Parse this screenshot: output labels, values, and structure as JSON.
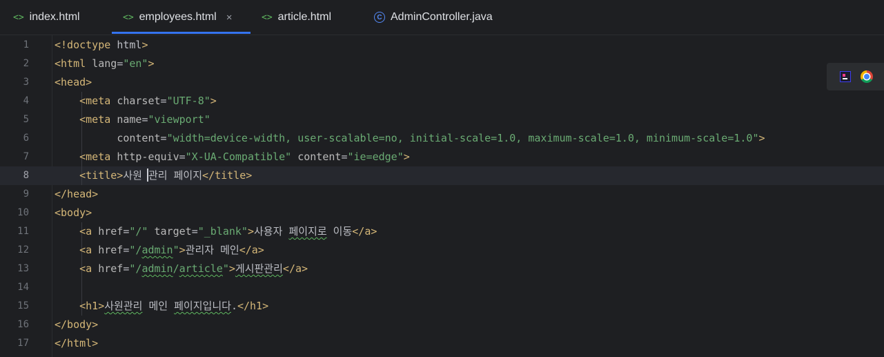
{
  "tabs": [
    {
      "icon": "<>",
      "label": "index.html"
    },
    {
      "icon": "<>",
      "label": "employees.html",
      "close": "×"
    },
    {
      "icon": "<>",
      "label": "article.html"
    },
    {
      "icon": "C",
      "label": "AdminController.java"
    }
  ],
  "lines": [
    {
      "n": "1",
      "parts": [
        [
          "tag",
          "<!doctype "
        ],
        [
          "txt",
          "html"
        ],
        [
          "tag",
          ">"
        ]
      ]
    },
    {
      "n": "2",
      "parts": [
        [
          "tag",
          "<html "
        ],
        [
          "attr",
          "lang"
        ],
        [
          "txt",
          "="
        ],
        [
          "str",
          "\"en\""
        ],
        [
          "tag",
          ">"
        ]
      ]
    },
    {
      "n": "3",
      "parts": [
        [
          "tag",
          "<head>"
        ]
      ]
    },
    {
      "n": "4",
      "parts": [
        [
          "txt",
          "    "
        ],
        [
          "tag",
          "<meta "
        ],
        [
          "attr",
          "charset"
        ],
        [
          "txt",
          "="
        ],
        [
          "str",
          "\"UTF-8\""
        ],
        [
          "tag",
          ">"
        ]
      ]
    },
    {
      "n": "5",
      "parts": [
        [
          "txt",
          "    "
        ],
        [
          "tag",
          "<meta "
        ],
        [
          "attr",
          "name"
        ],
        [
          "txt",
          "="
        ],
        [
          "str",
          "\"viewport\""
        ]
      ]
    },
    {
      "n": "6",
      "parts": [
        [
          "txt",
          "          "
        ],
        [
          "attr",
          "content"
        ],
        [
          "txt",
          "="
        ],
        [
          "str",
          "\"width=device-width, user-scalable=no, initial-scale=1.0, maximum-scale=1.0, minimum-scale=1.0\""
        ],
        [
          "tag",
          ">"
        ]
      ]
    },
    {
      "n": "7",
      "parts": [
        [
          "txt",
          "    "
        ],
        [
          "tag",
          "<meta "
        ],
        [
          "attr",
          "http-equiv"
        ],
        [
          "txt",
          "="
        ],
        [
          "str",
          "\"X-UA-Compatible\""
        ],
        [
          "txt",
          " "
        ],
        [
          "attr",
          "content"
        ],
        [
          "txt",
          "="
        ],
        [
          "str",
          "\"ie=edge\""
        ],
        [
          "tag",
          ">"
        ]
      ]
    },
    {
      "n": "8",
      "parts": [
        [
          "txt",
          "    "
        ],
        [
          "tag",
          "<title>"
        ],
        [
          "txt",
          "사원 "
        ],
        [
          "caret",
          ""
        ],
        [
          "txt",
          "관리 페이지"
        ],
        [
          "tag",
          "</title>"
        ]
      ]
    },
    {
      "n": "9",
      "parts": [
        [
          "tag",
          "</head>"
        ]
      ]
    },
    {
      "n": "10",
      "parts": [
        [
          "tag",
          "<body>"
        ]
      ]
    },
    {
      "n": "11",
      "parts": [
        [
          "txt",
          "    "
        ],
        [
          "tag",
          "<a "
        ],
        [
          "attr",
          "href"
        ],
        [
          "txt",
          "="
        ],
        [
          "str",
          "\"/\""
        ],
        [
          "txt",
          " "
        ],
        [
          "attr",
          "target"
        ],
        [
          "txt",
          "="
        ],
        [
          "str",
          "\"_blank\""
        ],
        [
          "tag",
          ">"
        ],
        [
          "txt",
          "사용자 "
        ],
        [
          "wtxt",
          "페이지로"
        ],
        [
          "txt",
          " 이동"
        ],
        [
          "tag",
          "</a>"
        ]
      ]
    },
    {
      "n": "12",
      "parts": [
        [
          "txt",
          "    "
        ],
        [
          "tag",
          "<a "
        ],
        [
          "attr",
          "href"
        ],
        [
          "txt",
          "="
        ],
        [
          "str",
          "\"/"
        ],
        [
          "wstr",
          "admin"
        ],
        [
          "str",
          "\""
        ],
        [
          "tag",
          ">"
        ],
        [
          "txt",
          "관리자 메인"
        ],
        [
          "tag",
          "</a>"
        ]
      ]
    },
    {
      "n": "13",
      "parts": [
        [
          "txt",
          "    "
        ],
        [
          "tag",
          "<a "
        ],
        [
          "attr",
          "href"
        ],
        [
          "txt",
          "="
        ],
        [
          "str",
          "\"/"
        ],
        [
          "wstr",
          "admin"
        ],
        [
          "str",
          "/"
        ],
        [
          "wstr",
          "article"
        ],
        [
          "str",
          "\""
        ],
        [
          "tag",
          ">"
        ],
        [
          "wtxt",
          "게시판관리"
        ],
        [
          "tag",
          "</a>"
        ]
      ]
    },
    {
      "n": "14",
      "parts": []
    },
    {
      "n": "15",
      "parts": [
        [
          "txt",
          "    "
        ],
        [
          "tag",
          "<h1>"
        ],
        [
          "wtxt",
          "사원관리"
        ],
        [
          "txt",
          " 메인 "
        ],
        [
          "wtxt",
          "페이지입니다"
        ],
        [
          "txt",
          "."
        ],
        [
          "tag",
          "</h1>"
        ]
      ]
    },
    {
      "n": "16",
      "parts": [
        [
          "tag",
          "</body>"
        ]
      ]
    },
    {
      "n": "17",
      "parts": [
        [
          "tag",
          "</html>"
        ]
      ]
    }
  ],
  "current_line": "8",
  "toolbar_icons": [
    "jetbrains-icon",
    "chrome-icon"
  ],
  "colors": {
    "tag": "#d5b778",
    "attr": "#bababa",
    "string": "#6aab73",
    "text": "#bcbec4",
    "accent": "#3574f0"
  }
}
